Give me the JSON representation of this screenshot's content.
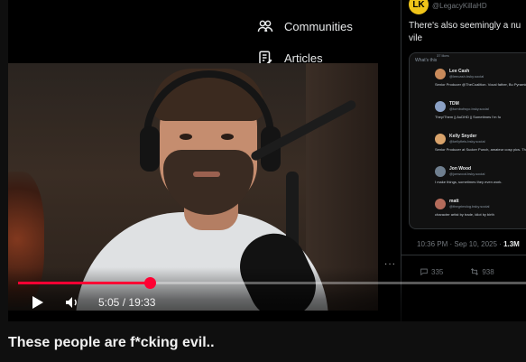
{
  "video": {
    "current_time": "5:05",
    "separator": "/",
    "duration": "19:33",
    "progress_fraction": 0.26,
    "accent_color": "#ff0033"
  },
  "title": "These people are f*cking evil..",
  "x_nav": {
    "communities": "Communities",
    "articles": "Articles"
  },
  "x_post": {
    "avatar_text": "LK",
    "handle": "@LegacyKillaHD",
    "text_line1": "There's also seemingly a nu",
    "text_line2": "vile",
    "embed_header": "What's this",
    "embed_likes": "37 likes",
    "replies": [
      {
        "name": "Lee Cash",
        "sub": "@leecash.bsky.social",
        "bio": "Senior Producer @TheCoalition. Vocal father, Bu Pyramids. Renowned coffee smuggler. Space B"
      },
      {
        "name": "TDM",
        "sub": "@tombofwyo.bsky.social",
        "bio": "They/Them || AuDHD || Sometimes I'm fu"
      },
      {
        "name": "Kelly Snyder",
        "sub": "@kellyfiels.bsky.social",
        "bio": "Senior Producer at Sucker Punch, amateur cosp pics. They/She"
      },
      {
        "name": "Jon Wood",
        "sub": "@jonwood.bsky.social",
        "bio": "I make things, sometimes they even work."
      },
      {
        "name": "matt",
        "sub": "@thegrimdog.bsky.social",
        "bio": "character artist by trade, idiot by birth"
      }
    ],
    "meta_time": "10:36 PM · Sep 10, 2025 · ",
    "meta_views": "1.3M",
    "comments": "335",
    "reposts": "938"
  },
  "icons": {
    "play": "play-icon",
    "volume": "volume-icon",
    "communities": "communities-icon",
    "articles": "articles-icon",
    "comment": "comment-icon",
    "repost": "repost-icon"
  }
}
